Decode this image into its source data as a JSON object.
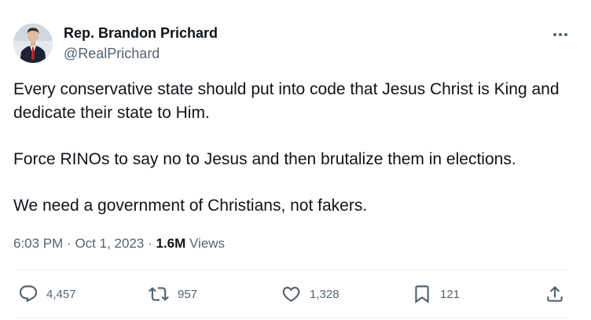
{
  "author": {
    "display_name": "Rep. Brandon Prichard",
    "handle": "@RealPrichard",
    "avatar_icon": "avatar-photo"
  },
  "tweet": {
    "paragraphs": [
      "Every conservative state should put into code that Jesus Christ is King and dedicate their state to Him.",
      "Force RINOs to say no to Jesus and then brutalize them in elections.",
      "We need a government of Christians, not fakers."
    ],
    "time": "6:03 PM",
    "separator": "·",
    "date": "Oct 1, 2023",
    "views_count": "1.6M",
    "views_label": "Views"
  },
  "actions": {
    "replies": {
      "icon": "reply-icon",
      "count": "4,457"
    },
    "reposts": {
      "icon": "repost-icon",
      "count": "957"
    },
    "likes": {
      "icon": "like-icon",
      "count": "1,328"
    },
    "bookmarks": {
      "icon": "bookmark-icon",
      "count": "121"
    },
    "share": {
      "icon": "share-icon"
    },
    "more": {
      "icon": "more-options-icon"
    }
  },
  "colors": {
    "text_primary": "#0f1419",
    "text_secondary": "#536471",
    "divider": "#eff3f4"
  }
}
